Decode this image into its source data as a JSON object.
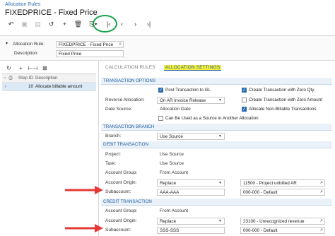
{
  "breadcrumb": "Allocation Rules",
  "title": "FIXEDPRICE - Fixed Price",
  "toolbar": [
    {
      "icon": "undo-icon",
      "glyph": "↶",
      "enabled": true
    },
    {
      "icon": "save-icon",
      "glyph": "▣",
      "enabled": false
    },
    {
      "icon": "save-close-icon",
      "glyph": "▤",
      "enabled": false
    },
    {
      "icon": "cancel-icon",
      "glyph": "↺",
      "enabled": true
    },
    {
      "icon": "add-icon",
      "glyph": "+",
      "enabled": true
    },
    {
      "icon": "delete-icon",
      "glyph": "🗑",
      "enabled": true
    },
    {
      "icon": "copy-paste-icon",
      "glyph": "⎘▾",
      "enabled": true
    },
    {
      "icon": "first-record-icon",
      "glyph": "|‹",
      "enabled": true
    },
    {
      "icon": "previous-record-icon",
      "glyph": "‹",
      "enabled": true
    },
    {
      "icon": "next-record-icon",
      "glyph": "›",
      "enabled": true
    },
    {
      "icon": "last-record-icon",
      "glyph": "›|",
      "enabled": true
    }
  ],
  "header": {
    "rule_label": "Allocation Rule:",
    "rule_value": "FIXEDPRICE - Fixed Price",
    "description_label": "Description:",
    "description_value": "Fixed Price"
  },
  "left_toolbar": [
    {
      "icon": "refresh-icon",
      "glyph": "↻"
    },
    {
      "icon": "add-row-icon",
      "glyph": "+"
    },
    {
      "icon": "fit-columns-icon",
      "glyph": "⊢⊣"
    },
    {
      "icon": "export-excel-icon",
      "glyph": "⊠"
    }
  ],
  "grid": {
    "columns": [
      "Step ID",
      "Description"
    ],
    "rows": [
      {
        "step_id": "10",
        "description": "Allocate billable amount"
      }
    ]
  },
  "tabs": {
    "calculation_rules": "CALCULATION RULES",
    "allocation_settings": "ALLOCATION SETTINGS"
  },
  "transaction_options": {
    "section": "TRANSACTION OPTIONS",
    "post_to_gl": "Post Transaction to GL",
    "reverse_label": "Reverse Allocation:",
    "reverse_value": "On AR Invoice Release",
    "date_label": "Date Source:",
    "date_value": "Allocation Date",
    "source_checkbox": "Can Be Used as a Source in Another Allocation",
    "zero_qty": "Create Transaction with Zero Qty.",
    "zero_amount": "Create Transaction with Zero Amount",
    "non_billable": "Allocate Non-Billable Transactions"
  },
  "transaction_branch": {
    "section": "TRANSACTION BRANCH",
    "branch_label": "Branch:",
    "branch_value": "Use Source"
  },
  "debit": {
    "section": "DEBIT TRANSACTION",
    "project_label": "Project:",
    "project_value": "Use Source",
    "task_label": "Task:",
    "task_value": "Use Source",
    "group_label": "Account Group:",
    "group_value": "From Account",
    "origin_label": "Account Origin:",
    "origin_value": "Replace",
    "account_value": "11500 - Project unbilled AR",
    "sub_label": "Subaccount:",
    "sub_value": "AAA-AAA",
    "sub_default": "000-000 - Default"
  },
  "credit": {
    "section": "CREDIT TRANSACTION",
    "group_label": "Account Group:",
    "group_value": "From Account",
    "origin_label": "Account Origin:",
    "origin_value": "Replace",
    "account_value": "23100 - Unrecognized revenue",
    "sub_label": "Subaccount:",
    "sub_value": "SSS-SSS",
    "sub_default": "000-000 - Default"
  },
  "colors": {
    "accent": "#1f5fa0",
    "highlight": "#f5ef3a",
    "annotation_arrow": "#e53935",
    "annotation_ring": "#16a34a"
  }
}
